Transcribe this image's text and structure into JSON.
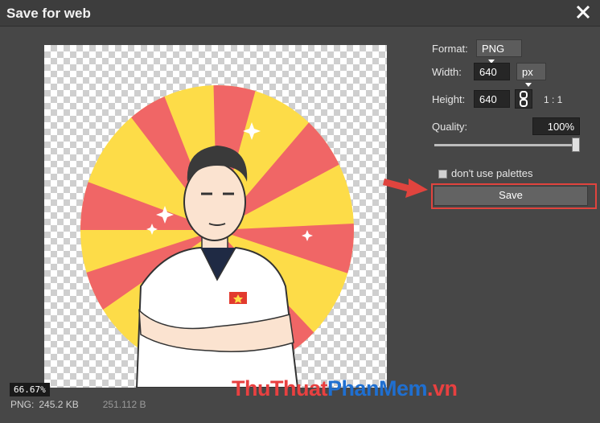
{
  "window": {
    "title": "Save for web"
  },
  "preview": {
    "zoom": "66.67%",
    "format_label": "PNG:",
    "file_size": "245.2 KB",
    "byte_size": "251.112 B"
  },
  "settings": {
    "format_label": "Format:",
    "format_value": "PNG",
    "width_label": "Width:",
    "width_value": "640",
    "unit_value": "px",
    "height_label": "Height:",
    "height_value": "640",
    "ratio": "1 : 1",
    "quality_label": "Quality:",
    "quality_value": "100%",
    "quality_level": 1.0,
    "palette_label": "don't use palettes",
    "palette_checked": false,
    "save_label": "Save"
  },
  "watermark": {
    "part1": "ThuThuat",
    "part2": "PhanMem",
    "part3": ".vn"
  },
  "colors": {
    "accent_red": "#e0443e",
    "sunburst_red": "#f06666",
    "sunburst_yellow": "#fddc48",
    "watermark_blue": "#1f6fd0"
  }
}
